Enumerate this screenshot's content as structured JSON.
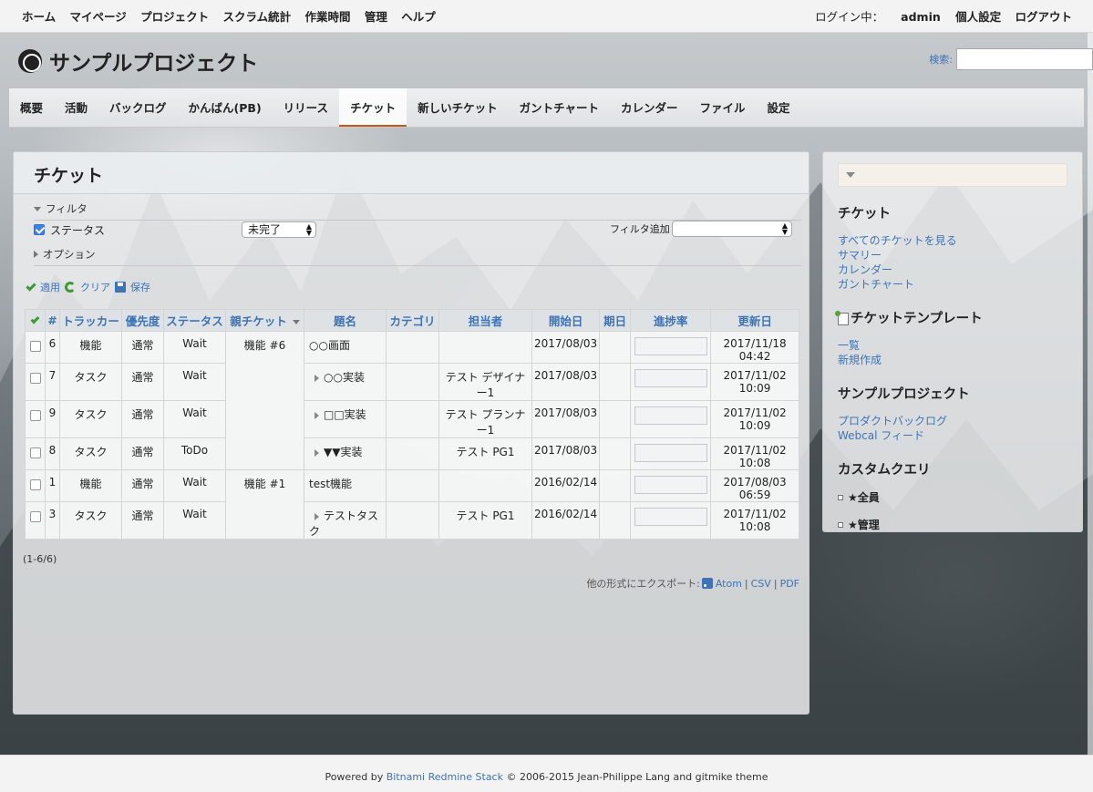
{
  "top_menu": {
    "items": [
      "ホーム",
      "マイページ",
      "プロジェクト",
      "スクラム統計",
      "作業時間",
      "管理",
      "ヘルプ"
    ],
    "logged_as_label": "ログイン中：",
    "user": "admin",
    "my_account": "個人設定",
    "logout": "ログアウト"
  },
  "header": {
    "project_title": "サンプルプロジェクト",
    "search_label": "検索:",
    "search_value": ""
  },
  "main_menu": {
    "tabs": [
      "概要",
      "活動",
      "バックログ",
      "かんばん(PB)",
      "リリース",
      "チケット",
      "新しいチケット",
      "ガントチャート",
      "カレンダー",
      "ファイル",
      "設定"
    ],
    "selected": "チケット"
  },
  "content": {
    "title": "チケット",
    "filters_label": "フィルタ",
    "status_filter_label": "ステータス",
    "status_filter_value": "未完了",
    "add_filter_label": "フィルタ追加",
    "add_filter_value": "",
    "options_label": "オプション",
    "apply": "適用",
    "clear": "クリア",
    "save": "保存"
  },
  "table": {
    "columns": [
      "#",
      "トラッカー",
      "優先度",
      "ステータス",
      "親チケット",
      "題名",
      "カテゴリ",
      "担当者",
      "開始日",
      "期日",
      "進捗率",
      "更新日"
    ],
    "rows": [
      {
        "id": "6",
        "tracker": "機能",
        "priority": "通常",
        "status": "Wait",
        "parent": "機能 #6",
        "subject": "○○画面",
        "category": "",
        "assignee": "",
        "start": "2017/08/03",
        "due": "",
        "updated": "2017/11/18 04:42"
      },
      {
        "id": "7",
        "tracker": "タスク",
        "priority": "通常",
        "status": "Wait",
        "parent": "",
        "subject": "○○実装",
        "category": "",
        "assignee": "テスト デザイナー1",
        "start": "2017/08/03",
        "due": "",
        "updated": "2017/11/02 10:09"
      },
      {
        "id": "9",
        "tracker": "タスク",
        "priority": "通常",
        "status": "Wait",
        "parent": "",
        "subject": "□□実装",
        "category": "",
        "assignee": "テスト プランナー1",
        "start": "2017/08/03",
        "due": "",
        "updated": "2017/11/02 10:09"
      },
      {
        "id": "8",
        "tracker": "タスク",
        "priority": "通常",
        "status": "ToDo",
        "parent": "",
        "subject": "▼▼実装",
        "category": "",
        "assignee": "テスト PG1",
        "start": "2017/08/03",
        "due": "",
        "updated": "2017/11/02 10:08"
      },
      {
        "id": "1",
        "tracker": "機能",
        "priority": "通常",
        "status": "Wait",
        "parent": "機能 #1",
        "subject": "test機能",
        "category": "",
        "assignee": "",
        "start": "2016/02/14",
        "due": "",
        "updated": "2017/08/03 06:59"
      },
      {
        "id": "3",
        "tracker": "タスク",
        "priority": "通常",
        "status": "Wait",
        "parent": "",
        "subject": "テストタスク",
        "category": "",
        "assignee": "テスト PG1",
        "start": "2016/02/14",
        "due": "",
        "updated": "2017/11/02 10:08"
      }
    ]
  },
  "pagination": "(1-6/6)",
  "export": {
    "label": "他の形式にエクスポート:",
    "atom": "Atom",
    "csv": "CSV",
    "pdf": "PDF"
  },
  "sidebar": {
    "issues_title": "チケット",
    "issues_links": [
      "すべてのチケットを見る",
      "サマリー",
      "カレンダー",
      "ガントチャート"
    ],
    "templates_title": "チケットテンプレート",
    "templates_links": [
      "一覧",
      "新規作成"
    ],
    "project_title": "サンプルプロジェクト",
    "project_links": [
      "プロダクトバックログ",
      "Webcal フィード"
    ],
    "custom_queries_title": "カスタムクエリ",
    "custom_queries": [
      "★全員",
      "★管理"
    ]
  },
  "footer": {
    "powered_by": "Powered by",
    "stack": "Bitnami Redmine Stack",
    "rest": "© 2006-2015 Jean-Philippe Lang and gitmike theme"
  }
}
